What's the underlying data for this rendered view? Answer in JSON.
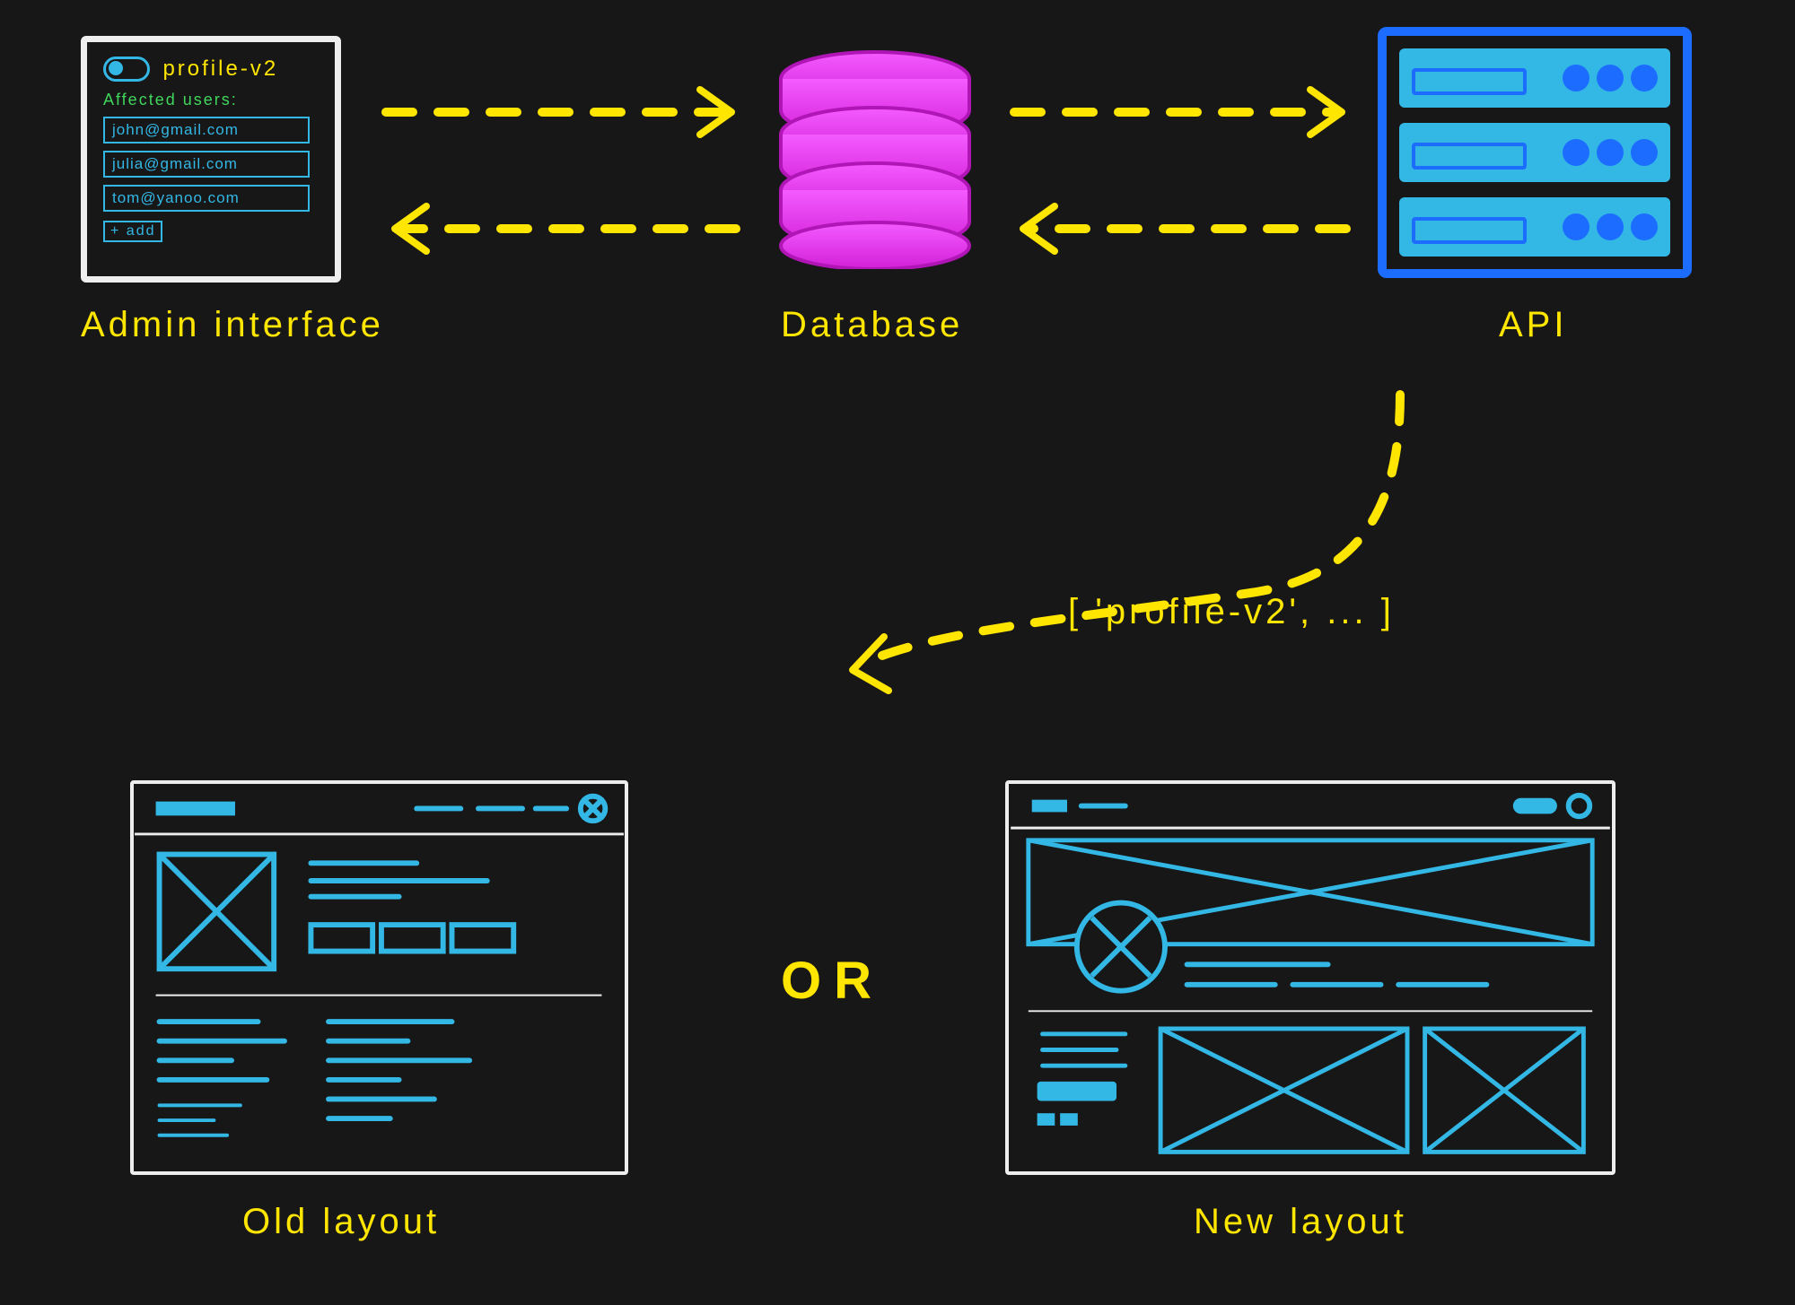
{
  "admin": {
    "feature_flag": "profile-v2",
    "subtitle": "Affected users:",
    "users": [
      "john@gmail.com",
      "julia@gmail.com",
      "tom@yanoo.com"
    ],
    "add_label": "+ add"
  },
  "labels": {
    "admin": "Admin interface",
    "database": "Database",
    "api": "API",
    "old_layout": "Old layout",
    "new_layout": "New layout",
    "or": "OR"
  },
  "api_response": "[ 'profile-v2', ... ]",
  "colors": {
    "background": "#171717",
    "chalk_white": "#eeeeee",
    "cyan": "#33b7e5",
    "blue": "#1c6dff",
    "yellow": "#ffe600",
    "magenta": "#e335e8",
    "green": "#3fd65c"
  },
  "diagram": {
    "nodes": [
      "admin_interface",
      "database",
      "api",
      "old_layout",
      "new_layout"
    ],
    "edges": [
      {
        "from": "admin_interface",
        "to": "database",
        "dir": "both"
      },
      {
        "from": "database",
        "to": "api",
        "dir": "both"
      },
      {
        "from": "api",
        "to": "client_decision",
        "payload": "['profile-v2', ...]"
      },
      {
        "from": "client_decision",
        "branches": [
          "old_layout",
          "new_layout"
        ]
      }
    ]
  }
}
